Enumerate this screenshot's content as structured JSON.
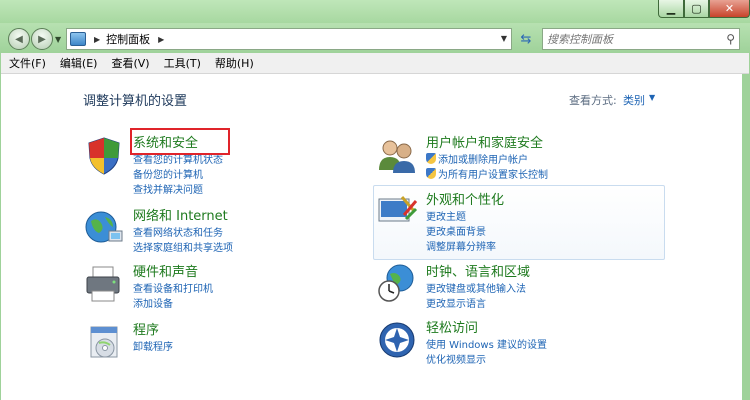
{
  "window": {
    "minimize_icon": "minimize-icon",
    "maximize_icon": "maximize-icon",
    "close_icon": "close-icon"
  },
  "nav": {
    "back_icon": "back-arrow-icon",
    "forward_icon": "forward-arrow-icon",
    "breadcrumb": [
      "控制面板"
    ],
    "search_placeholder": "搜索控制面板"
  },
  "menu": [
    "文件(F)",
    "编辑(E)",
    "查看(V)",
    "工具(T)",
    "帮助(H)"
  ],
  "page": {
    "title": "调整计算机的设置",
    "view_label": "查看方式:",
    "view_value": "类别"
  },
  "categories_left": [
    {
      "title": "系统和安全",
      "icon": "system-security-shield-icon",
      "links": [
        "查看您的计算机状态",
        "备份您的计算机",
        "查找并解决问题"
      ]
    },
    {
      "title": "网络和 Internet",
      "icon": "network-globe-icon",
      "links": [
        "查看网络状态和任务",
        "选择家庭组和共享选项"
      ]
    },
    {
      "title": "硬件和声音",
      "icon": "printer-icon",
      "links": [
        "查看设备和打印机",
        "添加设备"
      ]
    },
    {
      "title": "程序",
      "icon": "programs-disc-icon",
      "links": [
        "卸载程序"
      ]
    }
  ],
  "categories_right": [
    {
      "title": "用户帐户和家庭安全",
      "icon": "users-icon",
      "links": [
        "添加或删除用户帐户",
        "为所有用户设置家长控制"
      ]
    },
    {
      "title": "外观和个性化",
      "icon": "appearance-icon",
      "links": [
        "更改主题",
        "更改桌面背景",
        "调整屏幕分辨率"
      ]
    },
    {
      "title": "时钟、语言和区域",
      "icon": "clock-globe-icon",
      "links": [
        "更改键盘或其他输入法",
        "更改显示语言"
      ]
    },
    {
      "title": "轻松访问",
      "icon": "ease-of-access-icon",
      "links": [
        "使用 Windows 建议的设置",
        "优化视频显示"
      ]
    }
  ]
}
